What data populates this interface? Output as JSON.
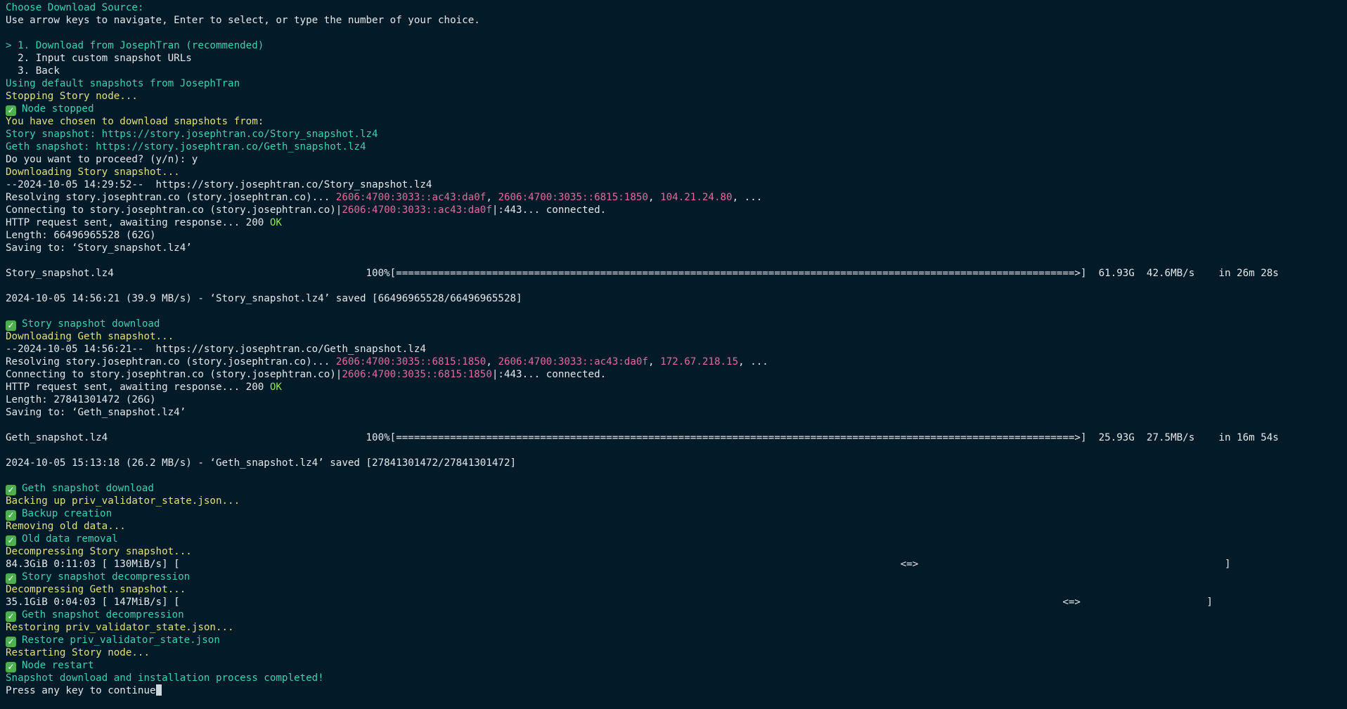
{
  "colors": {
    "background": "#031a28",
    "default_text": "#e6e8ea",
    "cyan": "#3fd0b3",
    "yellow": "#e2e07a",
    "pink": "#e06c9f",
    "green": "#8fe356",
    "check": "#4caf50"
  },
  "terminal": {
    "cursor_after_last_line": true,
    "lines": [
      {
        "segs": [
          {
            "t": "Choose Download Source:",
            "c": "cyan"
          }
        ]
      },
      {
        "segs": [
          {
            "t": "Use arrow keys to navigate, Enter to select, or type the number of your choice."
          }
        ]
      },
      {
        "segs": []
      },
      {
        "segs": [
          {
            "t": "> 1. Download from JosephTran (recommended)",
            "c": "cyan"
          }
        ]
      },
      {
        "segs": [
          {
            "t": "  2. Input custom snapshot URLs"
          }
        ]
      },
      {
        "segs": [
          {
            "t": "  3. Back"
          }
        ]
      },
      {
        "segs": [
          {
            "t": "Using default snapshots from JosephTran",
            "c": "cyan"
          }
        ]
      },
      {
        "segs": [
          {
            "t": "Stopping Story node...",
            "c": "yellow"
          }
        ]
      },
      {
        "check": true,
        "segs": [
          {
            "t": "Node stopped",
            "c": "cyan"
          }
        ]
      },
      {
        "segs": [
          {
            "t": "You have chosen to download snapshots from:",
            "c": "yellow"
          }
        ]
      },
      {
        "segs": [
          {
            "t": "Story snapshot: https://story.josephtran.co/Story_snapshot.lz4",
            "c": "cyan"
          }
        ]
      },
      {
        "segs": [
          {
            "t": "Geth snapshot: https://story.josephtran.co/Geth_snapshot.lz4",
            "c": "cyan"
          }
        ]
      },
      {
        "segs": [
          {
            "t": "Do you want to proceed? (y/n): y"
          }
        ]
      },
      {
        "segs": [
          {
            "t": "Downloading Story snapshot...",
            "c": "yellow"
          }
        ]
      },
      {
        "segs": [
          {
            "t": "--2024-10-05 14:29:52--  https://story.josephtran.co/Story_snapshot.lz4"
          }
        ]
      },
      {
        "segs": [
          {
            "t": "Resolving story.josephtran.co (story.josephtran.co)... "
          },
          {
            "t": "2606:4700:3033::ac43:da0f",
            "c": "pink"
          },
          {
            "t": ", "
          },
          {
            "t": "2606:4700:3035::6815:1850",
            "c": "pink"
          },
          {
            "t": ", "
          },
          {
            "t": "104.21.24.80",
            "c": "pink"
          },
          {
            "t": ", ..."
          }
        ]
      },
      {
        "segs": [
          {
            "t": "Connecting to story.josephtran.co (story.josephtran.co)|"
          },
          {
            "t": "2606:4700:3033::ac43:da0f",
            "c": "pink"
          },
          {
            "t": "|:443... connected."
          }
        ]
      },
      {
        "segs": [
          {
            "t": "HTTP request sent, awaiting response... 200 "
          },
          {
            "t": "OK",
            "c": "green"
          }
        ]
      },
      {
        "segs": [
          {
            "t": "Length: 66496965528 (62G)"
          }
        ]
      },
      {
        "segs": [
          {
            "t": "Saving to: ‘Story_snapshot.lz4’"
          }
        ]
      },
      {
        "segs": []
      },
      {
        "segs": [
          {
            "t": "Story_snapshot.lz4                                          100%[=================================================================================================================>]  61.93G  42.6MB/s    in 26m 28s"
          }
        ]
      },
      {
        "segs": []
      },
      {
        "segs": [
          {
            "t": "2024-10-05 14:56:21 (39.9 MB/s) - ‘Story_snapshot.lz4’ saved [66496965528/66496965528]"
          }
        ]
      },
      {
        "segs": []
      },
      {
        "check": true,
        "segs": [
          {
            "t": "Story snapshot download",
            "c": "cyan"
          }
        ]
      },
      {
        "segs": [
          {
            "t": "Downloading Geth snapshot...",
            "c": "yellow"
          }
        ]
      },
      {
        "segs": [
          {
            "t": "--2024-10-05 14:56:21--  https://story.josephtran.co/Geth_snapshot.lz4"
          }
        ]
      },
      {
        "segs": [
          {
            "t": "Resolving story.josephtran.co (story.josephtran.co)... "
          },
          {
            "t": "2606:4700:3035::6815:1850",
            "c": "pink"
          },
          {
            "t": ", "
          },
          {
            "t": "2606:4700:3033::ac43:da0f",
            "c": "pink"
          },
          {
            "t": ", "
          },
          {
            "t": "172.67.218.15",
            "c": "pink"
          },
          {
            "t": ", ..."
          }
        ]
      },
      {
        "segs": [
          {
            "t": "Connecting to story.josephtran.co (story.josephtran.co)|"
          },
          {
            "t": "2606:4700:3035::6815:1850",
            "c": "pink"
          },
          {
            "t": "|:443... connected."
          }
        ]
      },
      {
        "segs": [
          {
            "t": "HTTP request sent, awaiting response... 200 "
          },
          {
            "t": "OK",
            "c": "green"
          }
        ]
      },
      {
        "segs": [
          {
            "t": "Length: 27841301472 (26G)"
          }
        ]
      },
      {
        "segs": [
          {
            "t": "Saving to: ‘Geth_snapshot.lz4’"
          }
        ]
      },
      {
        "segs": []
      },
      {
        "segs": [
          {
            "t": "Geth_snapshot.lz4                                           100%[=================================================================================================================>]  25.93G  27.5MB/s    in 16m 54s"
          }
        ]
      },
      {
        "segs": []
      },
      {
        "segs": [
          {
            "t": "2024-10-05 15:13:18 (26.2 MB/s) - ‘Geth_snapshot.lz4’ saved [27841301472/27841301472]"
          }
        ]
      },
      {
        "segs": []
      },
      {
        "check": true,
        "segs": [
          {
            "t": "Geth snapshot download",
            "c": "cyan"
          }
        ]
      },
      {
        "segs": [
          {
            "t": "Backing up priv_validator_state.json...",
            "c": "yellow"
          }
        ]
      },
      {
        "check": true,
        "segs": [
          {
            "t": "Backup creation",
            "c": "cyan"
          }
        ]
      },
      {
        "segs": [
          {
            "t": "Removing old data...",
            "c": "yellow"
          }
        ]
      },
      {
        "check": true,
        "segs": [
          {
            "t": "Old data removal",
            "c": "cyan"
          }
        ]
      },
      {
        "segs": [
          {
            "t": "Decompressing Story snapshot...",
            "c": "yellow"
          }
        ]
      },
      {
        "segs": [
          {
            "t": "84.3GiB 0:11:03 [ 130MiB/s] [                                                                                                                        <=>                                                   ]"
          }
        ]
      },
      {
        "check": true,
        "segs": [
          {
            "t": "Story snapshot decompression",
            "c": "cyan"
          }
        ]
      },
      {
        "segs": [
          {
            "t": "Decompressing Geth snapshot...",
            "c": "yellow"
          }
        ]
      },
      {
        "segs": [
          {
            "t": "35.1GiB 0:04:03 [ 147MiB/s] [                                                                                                                                                   <=>                     ]"
          }
        ]
      },
      {
        "check": true,
        "segs": [
          {
            "t": "Geth snapshot decompression",
            "c": "cyan"
          }
        ]
      },
      {
        "segs": [
          {
            "t": "Restoring priv_validator_state.json...",
            "c": "yellow"
          }
        ]
      },
      {
        "check": true,
        "segs": [
          {
            "t": "Restore priv_validator_state.json",
            "c": "cyan"
          }
        ]
      },
      {
        "segs": [
          {
            "t": "Restarting Story node...",
            "c": "yellow"
          }
        ]
      },
      {
        "check": true,
        "segs": [
          {
            "t": "Node restart",
            "c": "cyan"
          }
        ]
      },
      {
        "segs": [
          {
            "t": "Snapshot download and installation process completed!",
            "c": "cyan"
          }
        ]
      },
      {
        "segs": [
          {
            "t": "Press any key to continue"
          }
        ],
        "cursor": true
      }
    ]
  }
}
